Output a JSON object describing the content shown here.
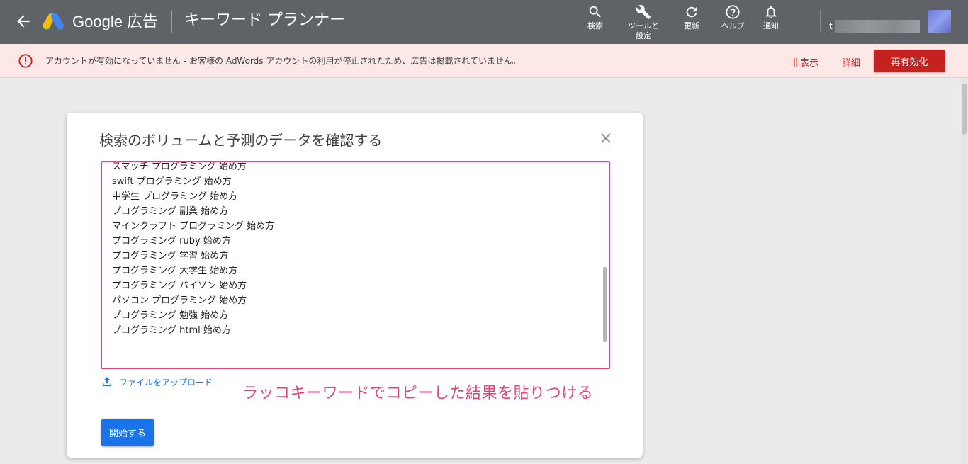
{
  "appbar": {
    "brand": "Google 広告",
    "tool_name": "キーワード プランナー",
    "tools": [
      {
        "label": "検索",
        "icon": "search-icon"
      },
      {
        "label": "ツールと\n設定",
        "icon": "wrench-icon"
      },
      {
        "label": "更新",
        "icon": "refresh-icon"
      },
      {
        "label": "ヘルプ",
        "icon": "help-icon"
      },
      {
        "label": "通知",
        "icon": "bell-icon"
      }
    ],
    "account_initial": "t"
  },
  "alert": {
    "message": "アカウントが有効になっていません - お客様の AdWords アカウントの利用が停止されたため、広告は掲載されていません。",
    "hide_label": "非表示",
    "details_label": "詳細",
    "reactivate_label": "再有効化"
  },
  "dialog": {
    "title": "検索のボリュームと予測のデータを確認する",
    "keywords": [
      "スマッチ プログラミング 始め方",
      "swift プログラミング 始め方",
      "中学生 プログラミング 始め方",
      "プログラミング 副業 始め方",
      "マインクラフト プログラミング 始め方",
      "プログラミング ruby 始め方",
      "プログラミング 学習 始め方",
      "プログラミング 大学生 始め方",
      "プログラミング パイソン 始め方",
      "パソコン プログラミング 始め方",
      "プログラミング 勉強 始め方",
      "プログラミング html 始め方"
    ],
    "upload_label": "ファイルをアップロード",
    "annotation": "ラッコキーワードでコピーした結果を貼りつける",
    "start_label": "開始する"
  },
  "colors": {
    "appbar": "#5f6368",
    "alert_bg": "#fce8e6",
    "alert_red": "#c5221f",
    "primary_blue": "#1a73e8",
    "annotation_pink": "#e3447a"
  }
}
